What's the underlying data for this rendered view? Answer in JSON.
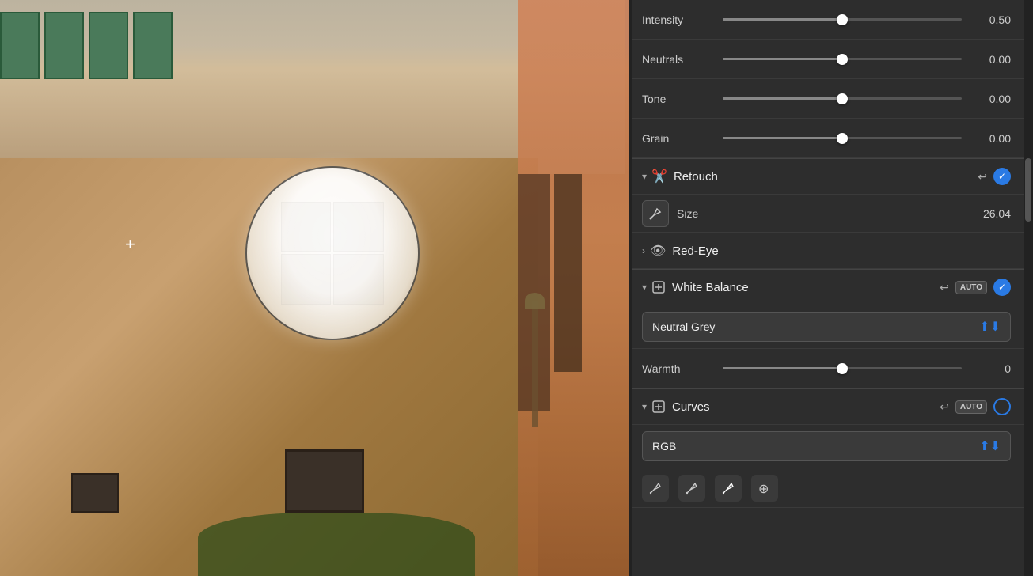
{
  "photo": {
    "crosshair_symbol": "+"
  },
  "panel": {
    "sliders": {
      "intensity": {
        "label": "Intensity",
        "value": 0.5,
        "value_display": "0.50",
        "fill_pct": 50
      },
      "neutrals": {
        "label": "Neutrals",
        "value": 0.0,
        "value_display": "0.00",
        "fill_pct": 50
      },
      "tone": {
        "label": "Tone",
        "value": 0.0,
        "value_display": "0.00",
        "fill_pct": 50
      },
      "grain": {
        "label": "Grain",
        "value": 0.0,
        "value_display": "0.00",
        "fill_pct": 50
      }
    },
    "retouch": {
      "title": "Retouch",
      "size_label": "Size",
      "size_value": "26.04"
    },
    "red_eye": {
      "title": "Red-Eye"
    },
    "white_balance": {
      "title": "White Balance",
      "preset_label": "Neutral Grey",
      "warmth_label": "Warmth",
      "warmth_value": "0",
      "warmth_fill_pct": 50,
      "auto_badge": "AUTO"
    },
    "curves": {
      "title": "Curves",
      "channel_label": "RGB",
      "auto_badge": "AUTO"
    }
  },
  "icons": {
    "chevron_down": "▾",
    "chevron_right": "›",
    "undo": "↩",
    "checkmark": "✓",
    "pencil_tool": "✏",
    "crosshair_add": "⊕"
  }
}
